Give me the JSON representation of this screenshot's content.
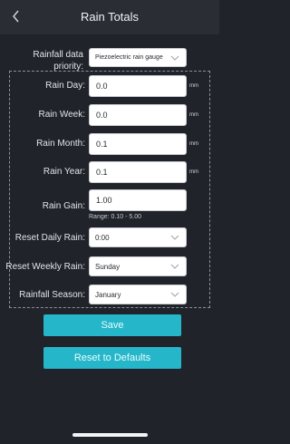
{
  "header": {
    "title": "Rain Totals"
  },
  "priority": {
    "label": "Rainfall data priority:",
    "value": "Piezoelectric rain gauge"
  },
  "fields": [
    {
      "label": "Rain Day:",
      "value": "0.0",
      "unit": "mm"
    },
    {
      "label": "Rain Week:",
      "value": "0.0",
      "unit": "mm"
    },
    {
      "label": "Rain Month:",
      "value": "0.1",
      "unit": "mm"
    },
    {
      "label": "Rain Year:",
      "value": "0.1",
      "unit": "mm"
    },
    {
      "label": "Rain Gain:",
      "value": "1.00",
      "hint": "Range: 0.10 - 5.00"
    }
  ],
  "selects": [
    {
      "label": "Reset Daily Rain:",
      "value": "0:00"
    },
    {
      "label": "Reset Weekly Rain:",
      "value": "Sunday"
    },
    {
      "label": "Rainfall Season:",
      "value": "January"
    }
  ],
  "buttons": {
    "save": "Save",
    "reset": "Reset to Defaults"
  },
  "icons": {
    "back": "chevron-left-icon",
    "dropdown": "chevron-down-icon"
  },
  "colors": {
    "accent": "#25b7c9",
    "background": "#20232a",
    "header": "#2a2d34"
  }
}
